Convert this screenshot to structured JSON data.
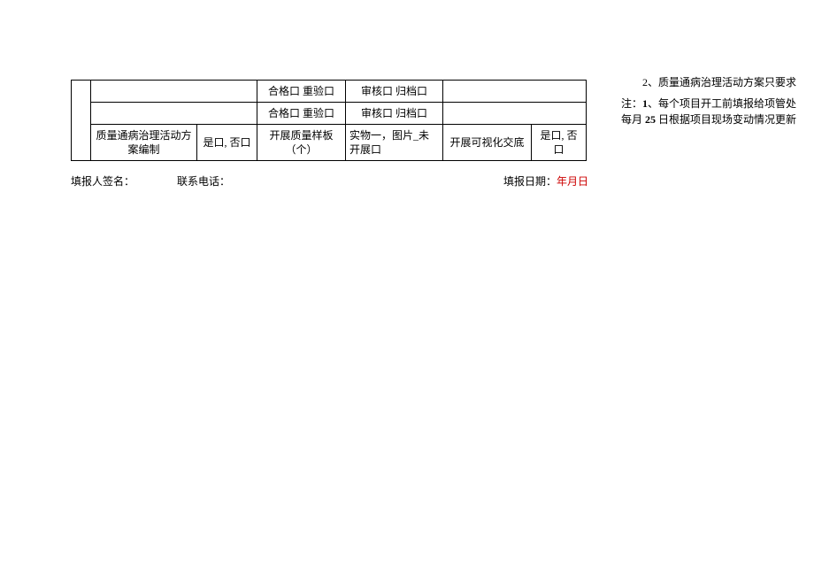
{
  "header": {
    "overlay_text": "2、质量通病治理活动方案只要求"
  },
  "notes": {
    "line1_prefix": "注：",
    "line1_num": "1",
    "line1_text": "、每个项目开工前填报给项管处",
    "line2_prefix": "每月",
    "line2_num": " 25 ",
    "line2_text": "日根据项目现场变动情况更新"
  },
  "table": {
    "r1_c3": "合格口 重验口",
    "r1_c4": "审核口 归档口",
    "r2_c3": "合格口 重验口",
    "r2_c4": "审核口 归档口",
    "r3_c1": "质量通病治理活动方案编制",
    "r3_c2": "是口, 否口",
    "r3_c3": "开展质量样板（个）",
    "r3_c4": "实物一，图片_未开展口",
    "r3_c5": "开展可视化交底",
    "r3_c6": "是口, 否口"
  },
  "footer": {
    "signer_label": "填报人签名：",
    "phone_label": "联系电话：",
    "date_label": "填报日期：",
    "date_value": "年月日"
  }
}
